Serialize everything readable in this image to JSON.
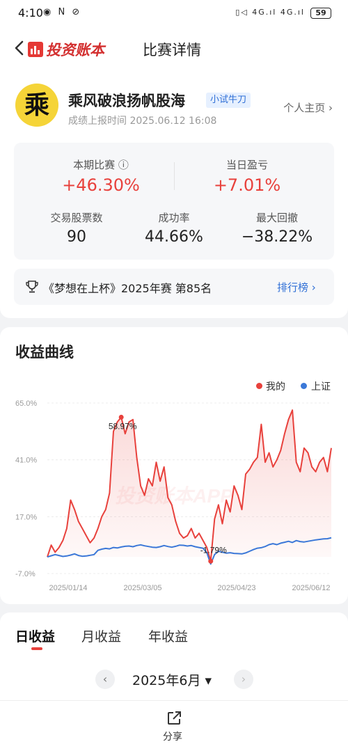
{
  "status_bar": {
    "time": "4:10",
    "left_icons": "◉ N ⊘",
    "right_icons": "▯◁ 4G.ıl 4G.ıl",
    "battery": "59"
  },
  "nav": {
    "logo_text": "投资账本",
    "title": "比赛详情"
  },
  "profile": {
    "avatar_char": "乘",
    "name": "乘风破浪扬帆股海",
    "badge": "小试牛刀",
    "report_time": "成绩上报时间 2025.06.12 16:08",
    "homepage_link": "个人主页 ›"
  },
  "stats": {
    "this_match_label": "本期比赛 ⓘ",
    "this_match_value": "+46.30%",
    "daily_pl_label": "当日盈亏",
    "daily_pl_value": "+7.01%",
    "stock_count_label": "交易股票数",
    "stock_count_value": "90",
    "success_rate_label": "成功率",
    "success_rate_value": "44.66%",
    "max_drawdown_label": "最大回撤",
    "max_drawdown_value": "−38.22%"
  },
  "rank": {
    "text": "《梦想在上杯》2025年赛 第85名",
    "link": "排行榜 ›"
  },
  "chart_section": {
    "title": "收益曲线",
    "watermark": "投资账本APP",
    "colors": {
      "mine": "#e8413c",
      "index": "#3b78d8"
    }
  },
  "chart_data": {
    "type": "line",
    "legend_position": "top-right",
    "x_ticks": [
      "2025/01/14",
      "2025/03/05",
      "2025/04/23",
      "2025/06/12"
    ],
    "y_ticks": [
      "65.0%",
      "41.0%",
      "17.0%",
      "-7.0%"
    ],
    "ylim": [
      -7.0,
      65.0
    ],
    "grid": true,
    "annotations": [
      "58.97%",
      "-1.79%"
    ],
    "series": [
      {
        "name": "我的",
        "values": [
          0,
          5,
          2,
          4,
          7,
          12,
          24,
          20,
          15,
          12,
          9,
          6,
          8,
          12,
          17,
          20,
          27,
          53,
          57,
          59,
          52,
          57,
          58,
          42,
          30,
          26,
          33,
          30,
          40,
          32,
          38,
          25,
          22,
          15,
          10,
          8,
          9,
          12,
          8,
          10,
          7,
          4,
          -1.79,
          16,
          22,
          14,
          24,
          19,
          30,
          26,
          20,
          35,
          37,
          40,
          42,
          56,
          40,
          44,
          38,
          41,
          45,
          52,
          58,
          62,
          40,
          36,
          46,
          44,
          38,
          36,
          40,
          42,
          36,
          46
        ]
      },
      {
        "name": "上证",
        "values": [
          0,
          0.5,
          1,
          0.6,
          0.2,
          0.4,
          0.8,
          1.3,
          0.6,
          0.3,
          0.4,
          0.7,
          1.0,
          2.8,
          3.3,
          3.6,
          3.4,
          4.0,
          3.8,
          4.2,
          4.5,
          4.6,
          4.3,
          4.8,
          5.1,
          4.7,
          4.4,
          4.1,
          4.0,
          4.3,
          4.8,
          4.4,
          4.1,
          4.5,
          5.0,
          4.9,
          4.6,
          4.8,
          4.3,
          4.0,
          3.7,
          1.8,
          -3.0,
          1.0,
          2.4,
          2.0,
          1.6,
          1.8,
          1.5,
          1.4,
          1.3,
          1.7,
          2.4,
          3.1,
          3.7,
          3.9,
          4.4,
          5.2,
          5.6,
          5.2,
          5.8,
          6.2,
          6.6,
          6.1,
          6.9,
          6.5,
          6.3,
          6.6,
          6.9,
          7.2,
          7.4,
          7.6,
          7.7,
          8.1
        ]
      }
    ]
  },
  "tabs": [
    "日收益",
    "月收益",
    "年收益"
  ],
  "month_selector": {
    "prev": "‹",
    "current": "2025年6月 ▾",
    "next": "›"
  },
  "share": {
    "label": "分享"
  }
}
